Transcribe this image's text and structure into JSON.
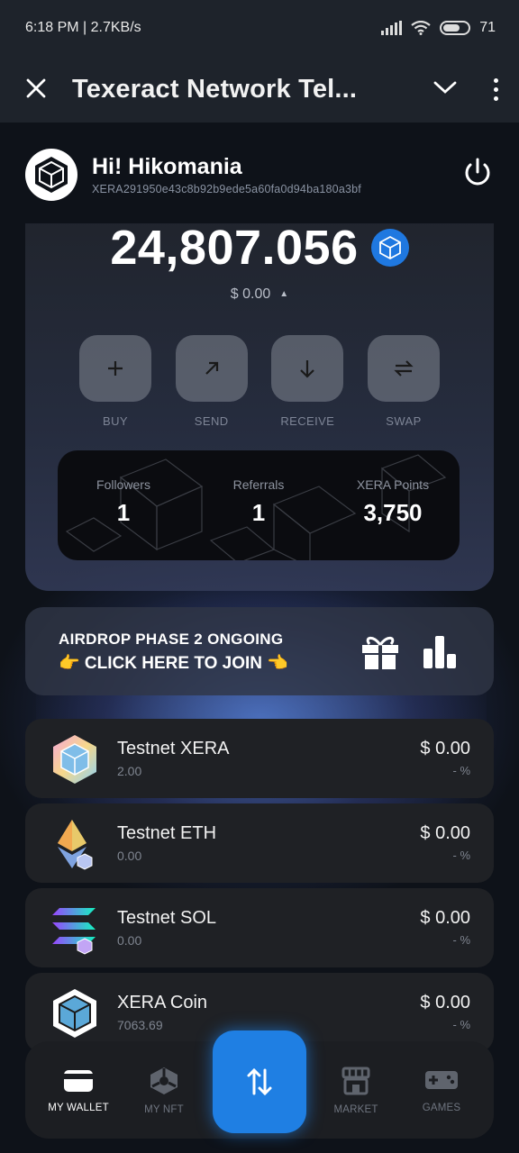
{
  "status_bar": {
    "time": "6:18 PM | 2.7KB/s",
    "battery": "71"
  },
  "app_bar": {
    "title": "Texeract Network Tel..."
  },
  "header": {
    "greeting": "Hi! Hikomania",
    "address": "XERA291950e43c8b92b9ede5a60fa0d94ba180a3bf"
  },
  "balance": {
    "amount": "24,807.056",
    "fiat": "$ 0.00"
  },
  "actions": [
    {
      "label": "BUY",
      "icon": "plus-icon"
    },
    {
      "label": "SEND",
      "icon": "arrow-up-right-icon"
    },
    {
      "label": "RECEIVE",
      "icon": "arrow-down-icon"
    },
    {
      "label": "SWAP",
      "icon": "swap-arrows-icon"
    }
  ],
  "stats": [
    {
      "label": "Followers",
      "value": "1"
    },
    {
      "label": "Referrals",
      "value": "1"
    },
    {
      "label": "XERA Points",
      "value": "3,750"
    }
  ],
  "airdrop": {
    "line1": "AIRDROP PHASE 2 ONGOING",
    "line2": "👉 CLICK HERE TO JOIN 👈"
  },
  "tokens": [
    {
      "name": "Testnet XERA",
      "qty": "2.00",
      "usd": "$ 0.00",
      "pct": "- %",
      "icon": "xera-testnet-icon"
    },
    {
      "name": "Testnet ETH",
      "qty": "0.00",
      "usd": "$ 0.00",
      "pct": "- %",
      "icon": "eth-icon"
    },
    {
      "name": "Testnet SOL",
      "qty": "0.00",
      "usd": "$ 0.00",
      "pct": "- %",
      "icon": "sol-icon"
    },
    {
      "name": "XERA Coin",
      "qty": "7063.69",
      "usd": "$ 0.00",
      "pct": "- %",
      "icon": "xera-coin-icon"
    }
  ],
  "nav": {
    "wallet": "MY WALLET",
    "nft": "MY NFT",
    "market": "MARKET",
    "games": "GAMES"
  },
  "colors": {
    "accent": "#1f7fe3",
    "card": "#1f2125",
    "appbar": "#1e232b"
  }
}
